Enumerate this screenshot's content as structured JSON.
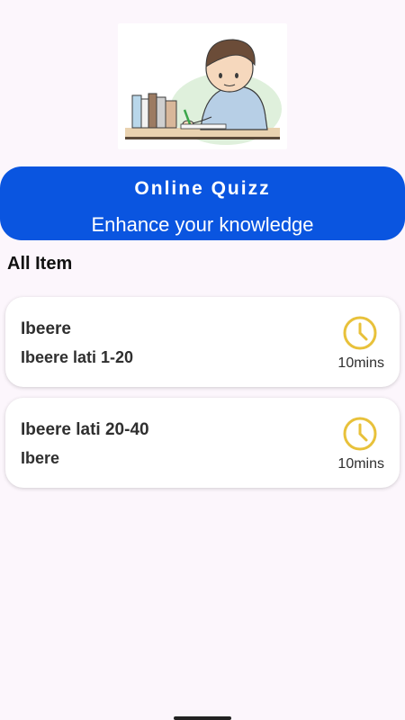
{
  "hero": {
    "image_icon": "student-studying-illustration"
  },
  "banner": {
    "title": "Online Quizz",
    "subtitle": "Enhance your knowledge"
  },
  "section": {
    "title": "All Item"
  },
  "items": [
    {
      "title": "Ibeere",
      "subtitle": "Ibeere lati 1-20",
      "duration": "10mins",
      "icon": "clock-icon"
    },
    {
      "title": "Ibeere lati 20-40",
      "subtitle": "Ibere",
      "duration": "10mins",
      "icon": "clock-icon"
    }
  ],
  "colors": {
    "accent": "#0a55e0",
    "clock": "#e8c13a",
    "background": "#fcf6fc"
  }
}
